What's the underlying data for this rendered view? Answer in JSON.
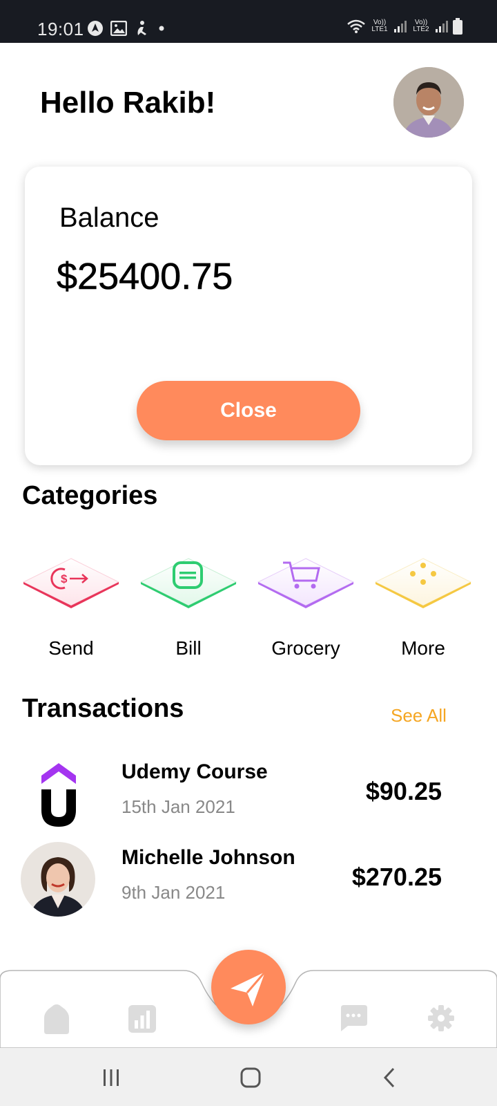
{
  "status_bar": {
    "time": "19:01",
    "sim1": "Vo)) LTE1",
    "sim2": "Vo)) LTE2"
  },
  "header": {
    "greeting": "Hello Rakib!",
    "avatar_icon": "user-avatar"
  },
  "balance_card": {
    "label": "Balance",
    "value": "$25400.75",
    "close_label": "Close"
  },
  "categories": {
    "title": "Categories",
    "items": [
      {
        "label": "Send",
        "icon": "send-money-icon",
        "color": "#e8355a"
      },
      {
        "label": "Bill",
        "icon": "bill-icon",
        "color": "#2ecc71"
      },
      {
        "label": "Grocery",
        "icon": "cart-icon",
        "color": "#b36bf0"
      },
      {
        "label": "More",
        "icon": "more-dots-icon",
        "color": "#f5c842"
      }
    ]
  },
  "transactions": {
    "title": "Transactions",
    "see_all": "See All",
    "items": [
      {
        "name": "Udemy Course",
        "date": "15th Jan 2021",
        "amount": "$90.25",
        "icon": "udemy-logo"
      },
      {
        "name": "Michelle Johnson",
        "date": "9th Jan 2021",
        "amount": "$270.25",
        "icon": "contact-avatar"
      }
    ]
  },
  "bottom_nav": {
    "items": [
      "home-icon",
      "stats-icon",
      "send-icon",
      "chat-icon",
      "settings-icon"
    ]
  },
  "colors": {
    "accent": "#ff8a5c",
    "see_all": "#f5a623",
    "status_bar": "#181b22"
  }
}
